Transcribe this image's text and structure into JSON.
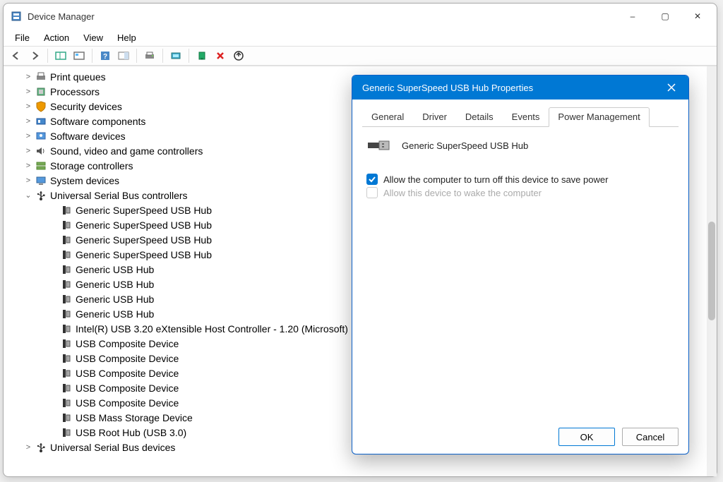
{
  "window": {
    "title": "Device Manager",
    "menubar": [
      "File",
      "Action",
      "View",
      "Help"
    ],
    "win_buttons": {
      "min": "–",
      "max": "▢",
      "close": "✕"
    }
  },
  "toolbar_icons": [
    "back-icon",
    "forward-icon",
    "sep",
    "show-hidden-icon",
    "refresh-icon",
    "sep",
    "help-icon",
    "properties-pane-icon",
    "sep",
    "print-icon",
    "sep",
    "scan-icon",
    "sep",
    "add-legacy-icon",
    "remove-icon",
    "update-driver-icon"
  ],
  "tree": {
    "collapsed": [
      {
        "label": "Print queues",
        "icon": "printer-icon"
      },
      {
        "label": "Processors",
        "icon": "cpu-icon"
      },
      {
        "label": "Security devices",
        "icon": "security-icon"
      },
      {
        "label": "Software components",
        "icon": "component-icon"
      },
      {
        "label": "Software devices",
        "icon": "software-device-icon"
      },
      {
        "label": "Sound, video and game controllers",
        "icon": "speaker-icon"
      },
      {
        "label": "Storage controllers",
        "icon": "storage-icon"
      },
      {
        "label": "System devices",
        "icon": "system-icon"
      }
    ],
    "expanded": {
      "label": "Universal Serial Bus controllers",
      "icon": "usb-icon",
      "children": [
        "Generic SuperSpeed USB Hub",
        "Generic SuperSpeed USB Hub",
        "Generic SuperSpeed USB Hub",
        "Generic SuperSpeed USB Hub",
        "Generic USB Hub",
        "Generic USB Hub",
        "Generic USB Hub",
        "Generic USB Hub",
        "Intel(R) USB 3.20 eXtensible Host Controller - 1.20 (Microsoft)",
        "USB Composite Device",
        "USB Composite Device",
        "USB Composite Device",
        "USB Composite Device",
        "USB Composite Device",
        "USB Mass Storage Device",
        "USB Root Hub (USB 3.0)"
      ]
    },
    "truncated": {
      "label": "Universal Serial Bus devices",
      "icon": "usb-icon"
    }
  },
  "dialog": {
    "title": "Generic SuperSpeed USB Hub Properties",
    "tabs": [
      "General",
      "Driver",
      "Details",
      "Events",
      "Power Management"
    ],
    "active_tab_index": 4,
    "device_name": "Generic SuperSpeed USB Hub",
    "chk1": {
      "label": "Allow the computer to turn off this device to save power",
      "checked": true,
      "enabled": true
    },
    "chk2": {
      "label": "Allow this device to wake the computer",
      "checked": false,
      "enabled": false
    },
    "ok": "OK",
    "cancel": "Cancel"
  }
}
